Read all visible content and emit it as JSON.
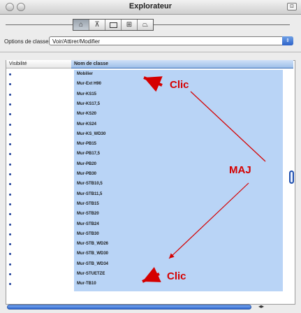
{
  "window": {
    "title": "Explorateur"
  },
  "toolbar": {
    "buttons": [
      {
        "icon": "building-icon"
      },
      {
        "icon": "stairs-icon"
      },
      {
        "icon": "window-icon"
      },
      {
        "icon": "table-icon"
      },
      {
        "icon": "cap-icon"
      }
    ]
  },
  "options": {
    "label": "Options de classes",
    "popup_value": "Voir/Attirer/Modifier"
  },
  "columns": {
    "visibility": "Visibilité",
    "class_name": "Nom de classe"
  },
  "rows": [
    "Mobilier",
    "Mur-Ext H90",
    "Mur-KS15",
    "Mur-KS17,5",
    "Mur-KS20",
    "Mur-KS24",
    "Mur-KS_WD30",
    "Mur-PB15",
    "Mur-PB17,5",
    "Mur-PB20",
    "Mur-PB30",
    "Mur-STB10,5",
    "Mur-STB11,5",
    "Mur-STB15",
    "Mur-STB20",
    "Mur-STB24",
    "Mur-STB30",
    "Mur-STB_WD26",
    "Mur-STB_WD30",
    "Mur-STB_WD34",
    "Mur-STUETZE",
    "Mur-TB10"
  ],
  "annotations": {
    "clic_top": "Clic",
    "maj": "MAJ",
    "clic_bottom": "Clic"
  },
  "colors": {
    "selection": "#b9d4f6",
    "accent": "#2f68d0",
    "annotation": "#d50000"
  }
}
